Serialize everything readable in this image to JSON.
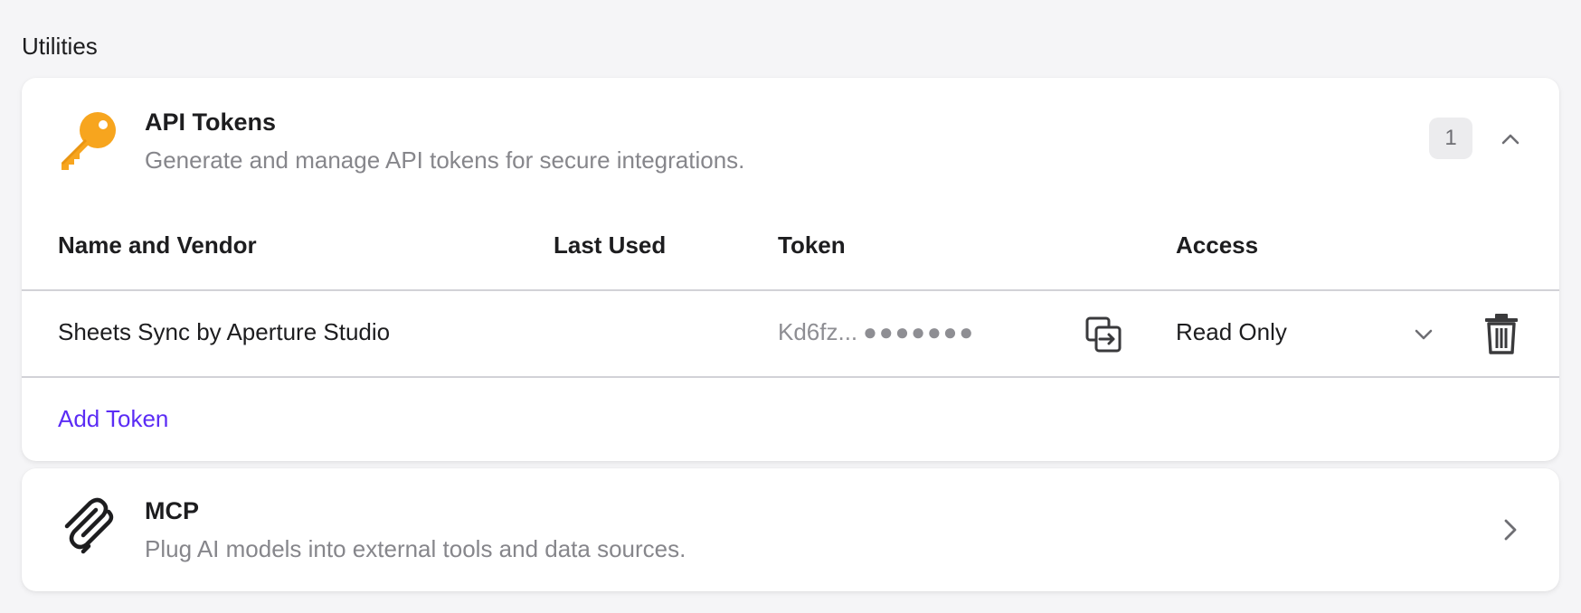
{
  "section": {
    "title": "Utilities"
  },
  "api_tokens": {
    "title": "API Tokens",
    "description": "Generate and manage API tokens for secure integrations.",
    "count": "1",
    "icon": "key-icon",
    "icon_color": "#f7a51e",
    "columns": {
      "name": "Name and Vendor",
      "last_used": "Last Used",
      "token": "Token",
      "access": "Access"
    },
    "rows": [
      {
        "name": "Sheets Sync by Aperture Studio",
        "last_used": "",
        "token_prefix": "Kd6fz...",
        "token_mask": "●●●●●●●",
        "access": "Read Only"
      }
    ],
    "add_label": "Add Token",
    "link_color": "#5b2cf5"
  },
  "mcp": {
    "title": "MCP",
    "description": "Plug AI models into external tools and data sources.",
    "icon": "mcp-icon"
  }
}
